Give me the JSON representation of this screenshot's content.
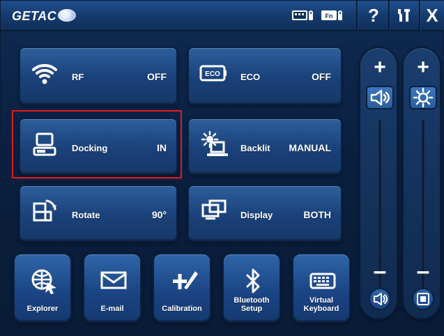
{
  "app": {
    "brand": "GETAC"
  },
  "tiles": [
    {
      "label": "RF",
      "value": "OFF",
      "icon": "wifi-icon"
    },
    {
      "label": "ECO",
      "value": "OFF",
      "icon": "eco-icon",
      "icon_text": "ECO"
    },
    {
      "label": "Docking",
      "value": "IN",
      "icon": "docking-icon"
    },
    {
      "label": "Backlit",
      "value": "MANUAL",
      "icon": "backlight-icon"
    },
    {
      "label": "Rotate",
      "value": "90°",
      "icon": "rotate-icon"
    },
    {
      "label": "Display",
      "value": "BOTH",
      "icon": "display-icon"
    }
  ],
  "small_buttons": [
    {
      "label": "Explorer",
      "icon": "globe-cursor-icon"
    },
    {
      "label": "E-mail",
      "icon": "envelope-icon"
    },
    {
      "label": "Calibration",
      "icon": "calibration-icon"
    },
    {
      "label": "Bluetooth\nSetup",
      "icon": "bluetooth-icon"
    },
    {
      "label": "Virtual\nKeyboard",
      "icon": "keyboard-icon"
    }
  ],
  "titlebar": {
    "help": "?",
    "close": "X"
  },
  "colors": {
    "highlight": "#e41b1b"
  }
}
